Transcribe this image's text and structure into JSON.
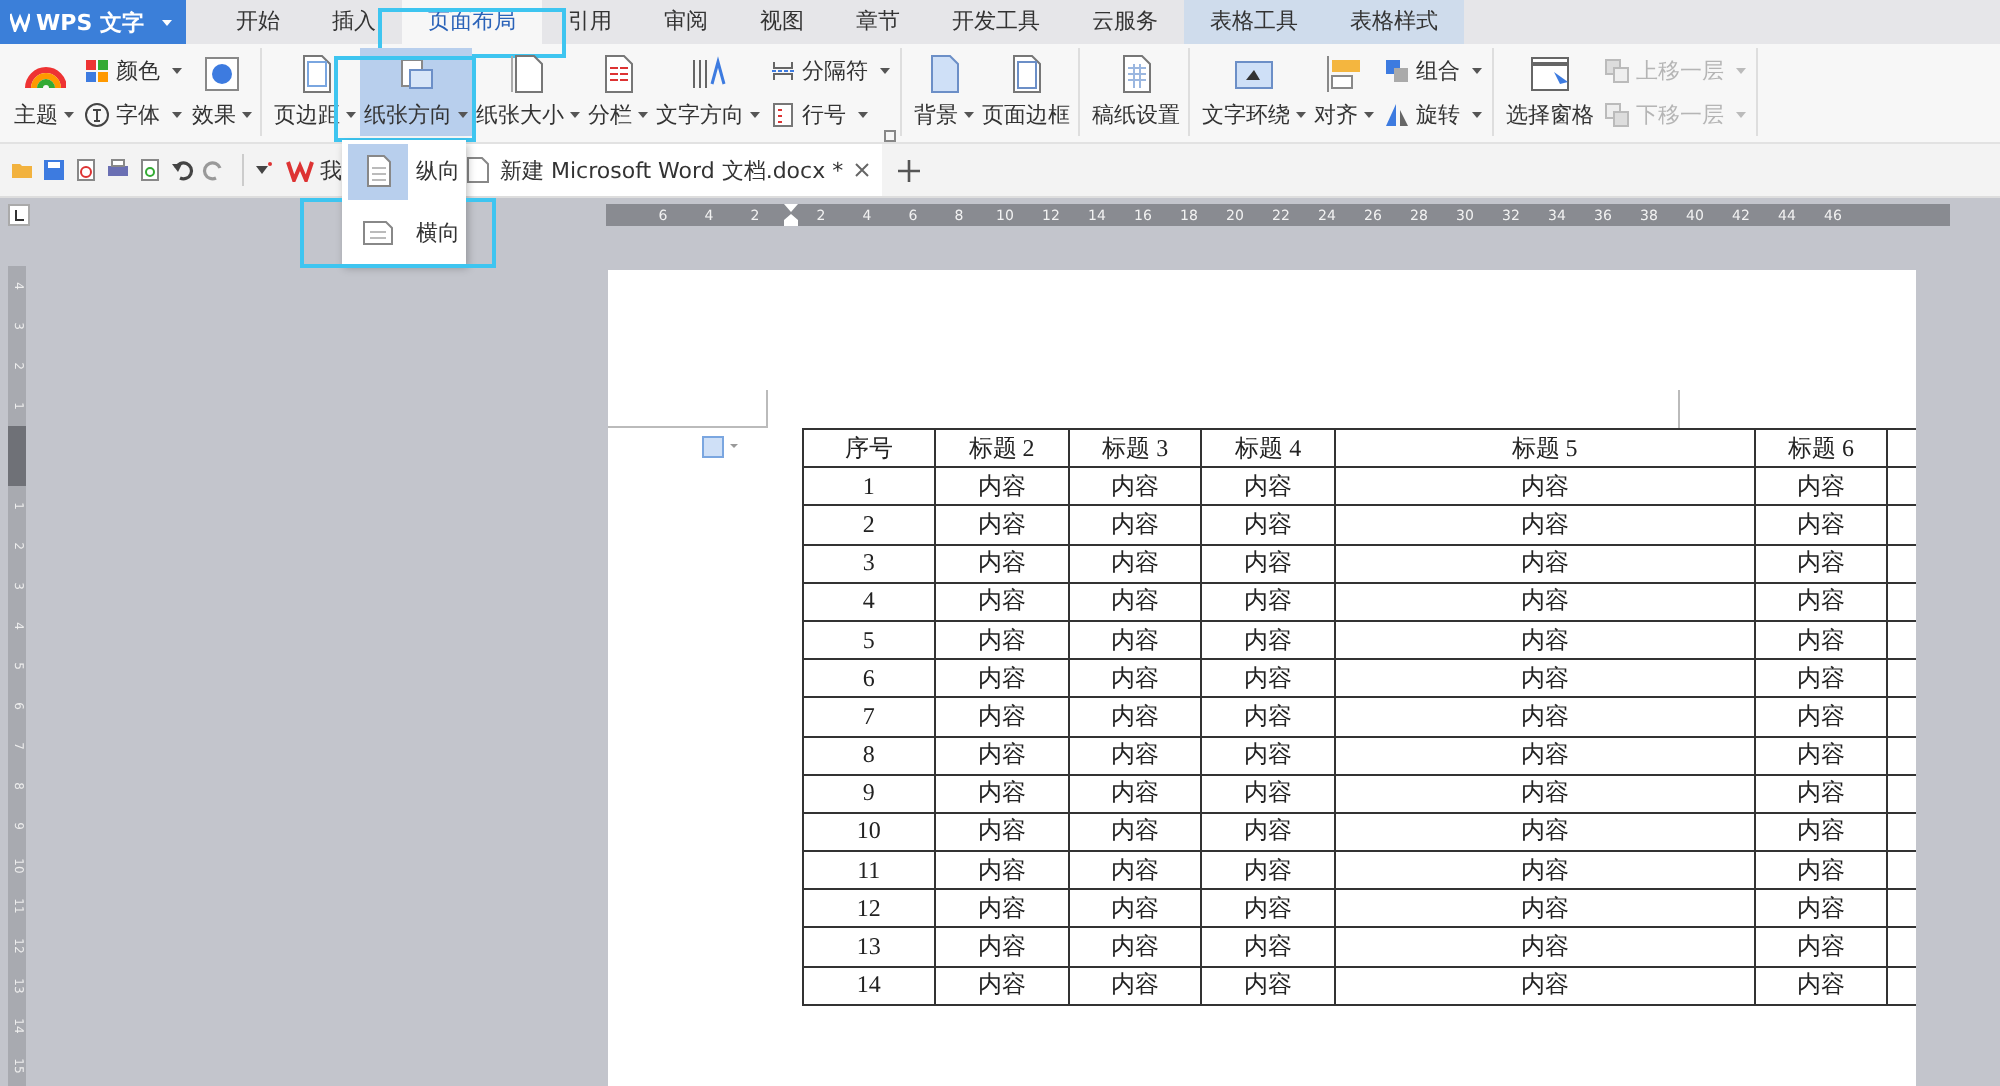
{
  "app": {
    "name": "WPS 文字"
  },
  "menu_tabs": [
    {
      "label": "开始",
      "selected": false,
      "contextual": false,
      "annotated": false
    },
    {
      "label": "插入",
      "selected": false,
      "contextual": false,
      "annotated": false
    },
    {
      "label": "页面布局",
      "selected": true,
      "contextual": false,
      "annotated": true
    },
    {
      "label": "引用",
      "selected": false,
      "contextual": false,
      "annotated": false
    },
    {
      "label": "审阅",
      "selected": false,
      "contextual": false,
      "annotated": false
    },
    {
      "label": "视图",
      "selected": false,
      "contextual": false,
      "annotated": false
    },
    {
      "label": "章节",
      "selected": false,
      "contextual": false,
      "annotated": false
    },
    {
      "label": "开发工具",
      "selected": false,
      "contextual": false,
      "annotated": false
    },
    {
      "label": "云服务",
      "selected": false,
      "contextual": false,
      "annotated": false
    },
    {
      "label": "表格工具",
      "selected": false,
      "contextual": true,
      "annotated": false
    },
    {
      "label": "表格样式",
      "selected": false,
      "contextual": true,
      "annotated": false
    }
  ],
  "ribbon": {
    "groups": [
      {
        "launcher": false,
        "columns": [
          {
            "kind": "large",
            "label": "主题",
            "dropdown": true,
            "pressed": false,
            "annotated": false
          },
          {
            "kind": "stack",
            "items": [
              {
                "label": "颜色",
                "dropdown": true,
                "disabled": false
              },
              {
                "label": "字体",
                "dropdown": true,
                "disabled": false
              }
            ]
          },
          {
            "kind": "large",
            "label": "效果",
            "dropdown": true,
            "pressed": false,
            "annotated": false
          }
        ]
      },
      {
        "launcher": true,
        "columns": [
          {
            "kind": "large",
            "label": "页边距",
            "dropdown": true,
            "pressed": false,
            "annotated": false
          },
          {
            "kind": "large",
            "label": "纸张方向",
            "dropdown": true,
            "pressed": true,
            "annotated": true
          },
          {
            "kind": "large",
            "label": "纸张大小",
            "dropdown": true,
            "pressed": false,
            "annotated": false
          },
          {
            "kind": "large",
            "label": "分栏",
            "dropdown": true,
            "pressed": false,
            "annotated": false
          },
          {
            "kind": "large",
            "label": "文字方向",
            "dropdown": true,
            "pressed": false,
            "annotated": false
          },
          {
            "kind": "stack",
            "items": [
              {
                "label": "分隔符",
                "dropdown": true,
                "disabled": false
              },
              {
                "label": "行号",
                "dropdown": true,
                "disabled": false
              }
            ]
          }
        ]
      },
      {
        "launcher": false,
        "columns": [
          {
            "kind": "large",
            "label": "背景",
            "dropdown": true,
            "pressed": false,
            "annotated": false
          },
          {
            "kind": "large",
            "label": "页面边框",
            "dropdown": false,
            "pressed": false,
            "annotated": false
          }
        ]
      },
      {
        "launcher": false,
        "columns": [
          {
            "kind": "large",
            "label": "稿纸设置",
            "dropdown": false,
            "pressed": false,
            "annotated": false
          }
        ]
      },
      {
        "launcher": false,
        "columns": [
          {
            "kind": "large",
            "label": "文字环绕",
            "dropdown": true,
            "pressed": false,
            "annotated": false
          },
          {
            "kind": "large",
            "label": "对齐",
            "dropdown": true,
            "pressed": false,
            "annotated": false
          },
          {
            "kind": "stack",
            "items": [
              {
                "label": "组合",
                "dropdown": true,
                "disabled": false
              },
              {
                "label": "旋转",
                "dropdown": true,
                "disabled": false
              }
            ]
          }
        ]
      },
      {
        "launcher": false,
        "columns": [
          {
            "kind": "large",
            "label": "选择窗格",
            "dropdown": false,
            "pressed": false,
            "annotated": false
          },
          {
            "kind": "stack",
            "items": [
              {
                "label": "上移一层",
                "dropdown": true,
                "disabled": true
              },
              {
                "label": "下移一层",
                "dropdown": true,
                "disabled": true
              }
            ]
          }
        ]
      }
    ]
  },
  "doc_tabs": [
    {
      "label": "我",
      "selected": false
    },
    {
      "label": "新建 Microsoft Word 文档.docx *",
      "selected": true,
      "closable": true
    }
  ],
  "paper_menu": {
    "items": [
      {
        "label": "纵向",
        "selected": true,
        "annotated": false
      },
      {
        "label": "横向",
        "selected": false,
        "annotated": true
      }
    ]
  },
  "ruler": {
    "left_labels": [
      "6",
      "4",
      "2"
    ],
    "labels": [
      "2",
      "4",
      "6",
      "8",
      "10",
      "12",
      "14",
      "16",
      "18",
      "20",
      "22",
      "24",
      "26",
      "28",
      "30",
      "32",
      "34",
      "36",
      "38",
      "40",
      "42",
      "44",
      "46"
    ]
  },
  "vertical_ruler": {
    "top_labels": [
      "4",
      "3",
      "2",
      "1"
    ],
    "labels": [
      "1",
      "2",
      "3",
      "4",
      "5",
      "6",
      "7",
      "8",
      "9",
      "10",
      "11",
      "12",
      "13",
      "14",
      "15"
    ]
  },
  "table": {
    "columns": [
      "序号",
      "标题 2",
      "标题 3",
      "标题 4",
      "标题 5",
      "标题 6"
    ],
    "rows": [
      [
        "1",
        "内容",
        "内容",
        "内容",
        "内容",
        "内容"
      ],
      [
        "2",
        "内容",
        "内容",
        "内容",
        "内容",
        "内容"
      ],
      [
        "3",
        "内容",
        "内容",
        "内容",
        "内容",
        "内容"
      ],
      [
        "4",
        "内容",
        "内容",
        "内容",
        "内容",
        "内容"
      ],
      [
        "5",
        "内容",
        "内容",
        "内容",
        "内容",
        "内容"
      ],
      [
        "6",
        "内容",
        "内容",
        "内容",
        "内容",
        "内容"
      ],
      [
        "7",
        "内容",
        "内容",
        "内容",
        "内容",
        "内容"
      ],
      [
        "8",
        "内容",
        "内容",
        "内容",
        "内容",
        "内容"
      ],
      [
        "9",
        "内容",
        "内容",
        "内容",
        "内容",
        "内容"
      ],
      [
        "10",
        "内容",
        "内容",
        "内容",
        "内容",
        "内容"
      ],
      [
        "11",
        "内容",
        "内容",
        "内容",
        "内容",
        "内容"
      ],
      [
        "12",
        "内容",
        "内容",
        "内容",
        "内容",
        "内容"
      ],
      [
        "13",
        "内容",
        "内容",
        "内容",
        "内容",
        "内容"
      ],
      [
        "14",
        "内容",
        "内容",
        "内容",
        "内容",
        "内容"
      ]
    ]
  }
}
